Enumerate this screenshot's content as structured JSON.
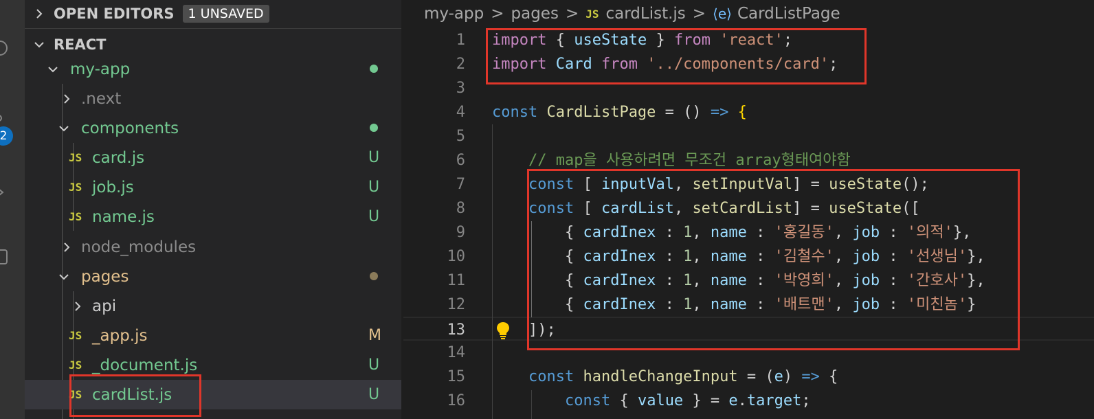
{
  "explorer": {
    "open_editors": {
      "title": "OPEN EDITORS",
      "badge": "1 UNSAVED"
    },
    "project": {
      "title": "REACT"
    },
    "tree": [
      {
        "label": "my-app",
        "kind": "folder-open",
        "status": "dot"
      },
      {
        "label": ".next",
        "kind": "folder",
        "status": ""
      },
      {
        "label": "components",
        "kind": "folder-open",
        "status": "dot"
      },
      {
        "label": "card.js",
        "kind": "js",
        "status": "U"
      },
      {
        "label": "job.js",
        "kind": "js",
        "status": "U"
      },
      {
        "label": "name.js",
        "kind": "js",
        "status": "U"
      },
      {
        "label": "node_modules",
        "kind": "folder",
        "status": ""
      },
      {
        "label": "pages",
        "kind": "folder-open",
        "status": "dot"
      },
      {
        "label": "api",
        "kind": "folder",
        "status": ""
      },
      {
        "label": "_app.js",
        "kind": "js",
        "status": "M"
      },
      {
        "label": "_document.js",
        "kind": "js",
        "status": "U"
      },
      {
        "label": "cardList.js",
        "kind": "js",
        "status": "U"
      }
    ],
    "js_badge": "JS"
  },
  "activity_bar": {
    "badge_count": "2"
  },
  "breadcrumb": {
    "items": [
      "my-app",
      "pages",
      "cardList.js",
      "CardListPage"
    ],
    "separator": ">",
    "js_badge": "JS",
    "symbol_icon": "⟨e⟩"
  },
  "editor": {
    "active_line": "13",
    "lines": [
      {
        "num": "1",
        "tokens": [
          [
            "kw",
            "import"
          ],
          [
            "punc",
            " { "
          ],
          [
            "var",
            "useState"
          ],
          [
            "punc",
            " } "
          ],
          [
            "kw",
            "from"
          ],
          [
            "punc",
            " "
          ],
          [
            "str",
            "'react'"
          ],
          [
            "punc",
            ";"
          ]
        ]
      },
      {
        "num": "2",
        "tokens": [
          [
            "kw",
            "import"
          ],
          [
            "punc",
            " "
          ],
          [
            "var",
            "Card"
          ],
          [
            "punc",
            " "
          ],
          [
            "kw",
            "from"
          ],
          [
            "punc",
            " "
          ],
          [
            "str",
            "'../components/card'"
          ],
          [
            "punc",
            ";"
          ]
        ]
      },
      {
        "num": "3",
        "tokens": []
      },
      {
        "num": "4",
        "tokens": [
          [
            "decl",
            "const"
          ],
          [
            "punc",
            " "
          ],
          [
            "fn",
            "CardListPage"
          ],
          [
            "punc",
            " = () "
          ],
          [
            "decl",
            "=>"
          ],
          [
            "punc",
            " "
          ],
          [
            "bracket",
            "{"
          ]
        ]
      },
      {
        "num": "5",
        "tokens": []
      },
      {
        "num": "6",
        "tokens": [
          [
            "punc",
            "    "
          ],
          [
            "cmt",
            "// map을 사용하려면 무조건 array형태여야함"
          ]
        ]
      },
      {
        "num": "7",
        "tokens": [
          [
            "punc",
            "    "
          ],
          [
            "decl",
            "const"
          ],
          [
            "punc",
            " [ "
          ],
          [
            "var",
            "inputVal"
          ],
          [
            "punc",
            ", "
          ],
          [
            "fn",
            "setInputVal"
          ],
          [
            "punc",
            "] = "
          ],
          [
            "fn",
            "useState"
          ],
          [
            "punc",
            "();"
          ]
        ]
      },
      {
        "num": "8",
        "tokens": [
          [
            "punc",
            "    "
          ],
          [
            "decl",
            "const"
          ],
          [
            "punc",
            " [ "
          ],
          [
            "var",
            "cardList"
          ],
          [
            "punc",
            ", "
          ],
          [
            "fn",
            "setCardList"
          ],
          [
            "punc",
            "] = "
          ],
          [
            "fn",
            "useState"
          ],
          [
            "punc",
            "(["
          ]
        ]
      },
      {
        "num": "9",
        "tokens": [
          [
            "punc",
            "        { "
          ],
          [
            "var",
            "cardInex"
          ],
          [
            "punc",
            " : "
          ],
          [
            "num",
            "1"
          ],
          [
            "punc",
            ", "
          ],
          [
            "var",
            "name"
          ],
          [
            "punc",
            " : "
          ],
          [
            "str",
            "'홍길동'"
          ],
          [
            "punc",
            ", "
          ],
          [
            "var",
            "job"
          ],
          [
            "punc",
            " : "
          ],
          [
            "str",
            "'의적'"
          ],
          [
            "punc",
            "},"
          ]
        ]
      },
      {
        "num": "10",
        "tokens": [
          [
            "punc",
            "        { "
          ],
          [
            "var",
            "cardInex"
          ],
          [
            "punc",
            " : "
          ],
          [
            "num",
            "1"
          ],
          [
            "punc",
            ", "
          ],
          [
            "var",
            "name"
          ],
          [
            "punc",
            " : "
          ],
          [
            "str",
            "'김철수'"
          ],
          [
            "punc",
            ", "
          ],
          [
            "var",
            "job"
          ],
          [
            "punc",
            " : "
          ],
          [
            "str",
            "'선생님'"
          ],
          [
            "punc",
            "},"
          ]
        ]
      },
      {
        "num": "11",
        "tokens": [
          [
            "punc",
            "        { "
          ],
          [
            "var",
            "cardInex"
          ],
          [
            "punc",
            " : "
          ],
          [
            "num",
            "1"
          ],
          [
            "punc",
            ", "
          ],
          [
            "var",
            "name"
          ],
          [
            "punc",
            " : "
          ],
          [
            "str",
            "'박영희'"
          ],
          [
            "punc",
            ", "
          ],
          [
            "var",
            "job"
          ],
          [
            "punc",
            " : "
          ],
          [
            "str",
            "'간호사'"
          ],
          [
            "punc",
            "},"
          ]
        ]
      },
      {
        "num": "12",
        "tokens": [
          [
            "punc",
            "        { "
          ],
          [
            "var",
            "cardInex"
          ],
          [
            "punc",
            " : "
          ],
          [
            "num",
            "1"
          ],
          [
            "punc",
            ", "
          ],
          [
            "var",
            "name"
          ],
          [
            "punc",
            " : "
          ],
          [
            "str",
            "'배트맨'"
          ],
          [
            "punc",
            ", "
          ],
          [
            "var",
            "job"
          ],
          [
            "punc",
            " : "
          ],
          [
            "str",
            "'미친놈'"
          ],
          [
            "punc",
            "}"
          ]
        ]
      },
      {
        "num": "13",
        "tokens": [
          [
            "punc",
            "    ]);"
          ]
        ]
      },
      {
        "num": "14",
        "tokens": []
      },
      {
        "num": "15",
        "tokens": [
          [
            "punc",
            "    "
          ],
          [
            "decl",
            "const"
          ],
          [
            "punc",
            " "
          ],
          [
            "fn",
            "handleChangeInput"
          ],
          [
            "punc",
            " = ("
          ],
          [
            "var",
            "e"
          ],
          [
            "punc",
            ") "
          ],
          [
            "decl",
            "=>"
          ],
          [
            "punc",
            " {"
          ]
        ]
      },
      {
        "num": "16",
        "tokens": [
          [
            "punc",
            "        "
          ],
          [
            "decl",
            "const"
          ],
          [
            "punc",
            " { "
          ],
          [
            "var",
            "value"
          ],
          [
            "punc",
            " } = "
          ],
          [
            "var",
            "e"
          ],
          [
            "punc",
            "."
          ],
          [
            "var",
            "target"
          ],
          [
            "punc",
            ";"
          ]
        ]
      }
    ]
  },
  "colors": {
    "editor_bg": "#1e1e1e",
    "sidebar_bg": "#252526",
    "highlight_box": "#e0362a",
    "git_untracked": "#73c991",
    "git_modified": "#e2c08d",
    "folder_green": "#73c991",
    "folder_yellow": "#e2c08d",
    "folder_gray": "#8c8c8c"
  }
}
